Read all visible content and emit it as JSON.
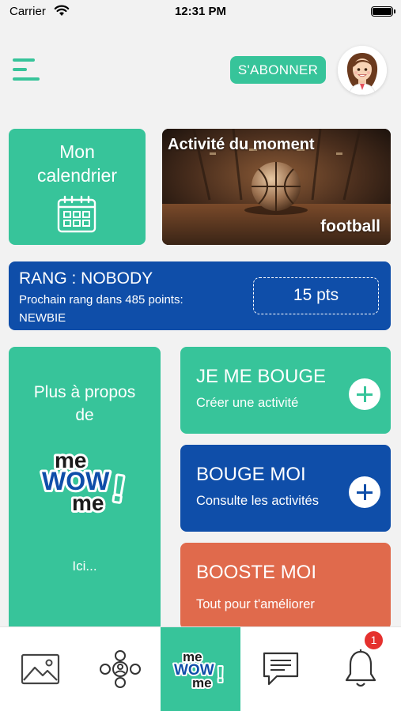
{
  "status_bar": {
    "carrier": "Carrier",
    "time": "12:31 PM"
  },
  "header": {
    "subscribe_label": "S'ABONNER"
  },
  "calendar_card": {
    "line1": "Mon",
    "line2": "calendrier"
  },
  "activity_card": {
    "title": "Activité du moment",
    "activity": "football"
  },
  "rank_card": {
    "title": "RANG : NOBODY",
    "next_rank": "Prochain rang dans 485 points:",
    "next_rank_name": "NEWBIE",
    "points": "15 pts"
  },
  "about_card": {
    "line1": "Plus à propos",
    "line2": "de",
    "logo_text": [
      "me",
      "WOW",
      "me",
      "!"
    ],
    "link": "Ici..."
  },
  "actions": [
    {
      "title": "JE ME BOUGE",
      "subtitle": "Créer une activité"
    },
    {
      "title": "BOUGE MOI",
      "subtitle": "Consulte les activités"
    },
    {
      "title": "BOOSTE MOI",
      "subtitle": "Tout pour t'améliorer"
    }
  ],
  "tab_bar": {
    "tabs": [
      "gallery-icon",
      "community-icon",
      "mewowme-logo",
      "chat-icon",
      "bell-icon"
    ],
    "notification_count": "1"
  },
  "colors": {
    "green": "#37c49a",
    "blue": "#0f4ea9",
    "orange": "#e06a4c",
    "badge": "#e5312e"
  }
}
